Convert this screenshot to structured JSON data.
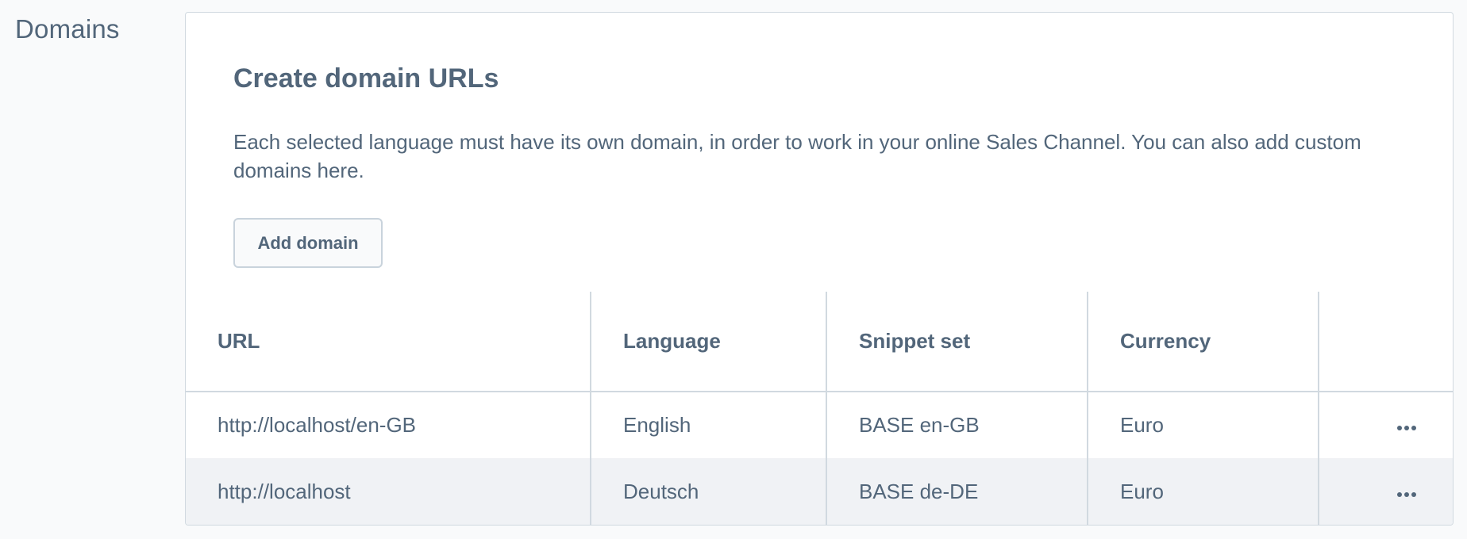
{
  "section": {
    "label": "Domains"
  },
  "card": {
    "title": "Create domain URLs",
    "description": "Each selected language must have its own domain, in order to work in your online Sales Channel. You can also add custom domains here.",
    "add_button_label": "Add domain"
  },
  "table": {
    "columns": [
      {
        "label": "URL"
      },
      {
        "label": "Language"
      },
      {
        "label": "Snippet set"
      },
      {
        "label": "Currency"
      },
      {
        "label": ""
      }
    ],
    "rows": [
      {
        "url": "http://localhost/en-GB",
        "language": "English",
        "snippet_set": "BASE en-GB",
        "currency": "Euro",
        "actions_icon": "more-horizontal-icon"
      },
      {
        "url": "http://localhost",
        "language": "Deutsch",
        "snippet_set": "BASE de-DE",
        "currency": "Euro",
        "actions_icon": "more-horizontal-icon"
      }
    ]
  },
  "colors": {
    "text": "#52667a",
    "border": "#d1d9e0",
    "row_alt": "#f0f2f5",
    "background": "#f9fafb"
  }
}
